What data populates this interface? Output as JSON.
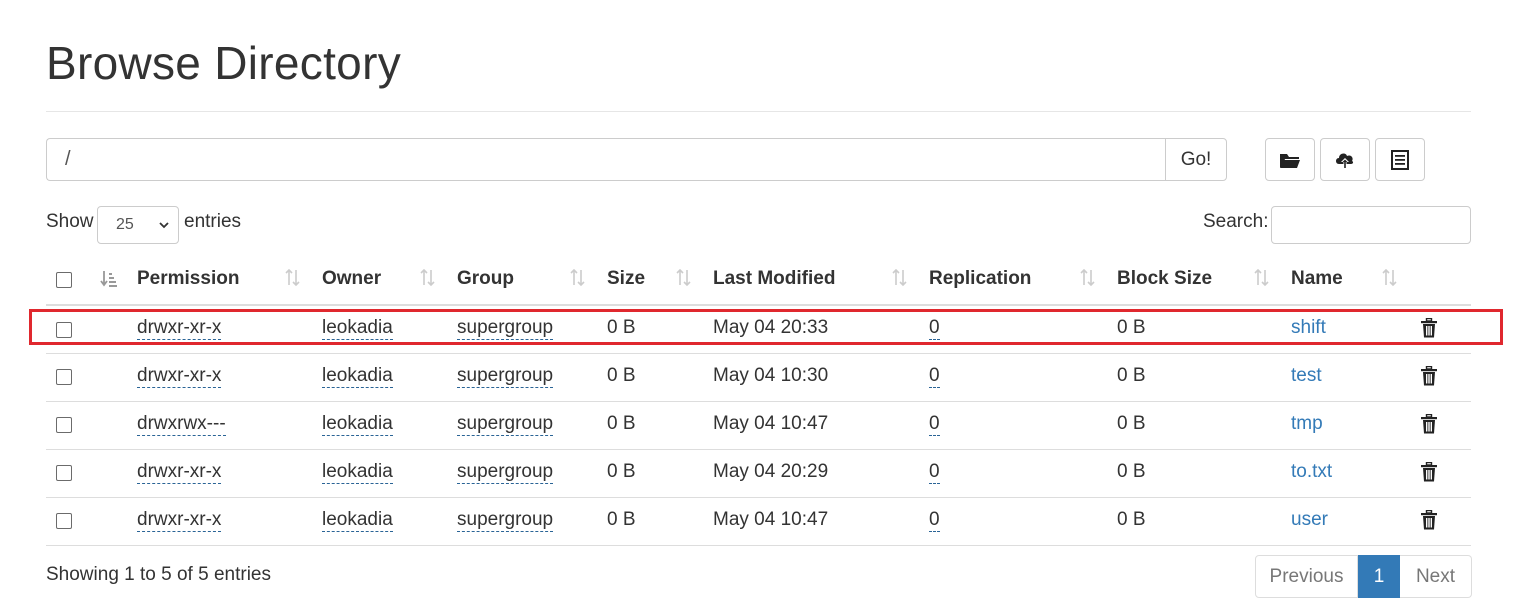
{
  "page": {
    "title": "Browse Directory"
  },
  "toolbar": {
    "path_value": "/",
    "go_label": "Go!",
    "buttons": [
      {
        "icon": "folder-open-icon",
        "tooltip": ""
      },
      {
        "icon": "cloud-upload-icon",
        "tooltip": ""
      },
      {
        "icon": "list-icon",
        "tooltip": ""
      }
    ]
  },
  "controls": {
    "show_label": "Show",
    "page_length": "25",
    "entries_label": "entries",
    "search_label": "Search:",
    "search_value": ""
  },
  "table": {
    "columns": [
      "Permission",
      "Owner",
      "Group",
      "Size",
      "Last Modified",
      "Replication",
      "Block Size",
      "Name"
    ],
    "rows": [
      {
        "permission": "drwxr-xr-x",
        "owner": "leokadia",
        "group": "supergroup",
        "size": "0 B",
        "modified": "May 04 20:33",
        "replication": "0",
        "block_size": "0 B",
        "name": "shift"
      },
      {
        "permission": "drwxr-xr-x",
        "owner": "leokadia",
        "group": "supergroup",
        "size": "0 B",
        "modified": "May 04 10:30",
        "replication": "0",
        "block_size": "0 B",
        "name": "test"
      },
      {
        "permission": "drwxrwx---",
        "owner": "leokadia",
        "group": "supergroup",
        "size": "0 B",
        "modified": "May 04 10:47",
        "replication": "0",
        "block_size": "0 B",
        "name": "tmp"
      },
      {
        "permission": "drwxr-xr-x",
        "owner": "leokadia",
        "group": "supergroup",
        "size": "0 B",
        "modified": "May 04 20:29",
        "replication": "0",
        "block_size": "0 B",
        "name": "to.txt"
      },
      {
        "permission": "drwxr-xr-x",
        "owner": "leokadia",
        "group": "supergroup",
        "size": "0 B",
        "modified": "May 04 10:47",
        "replication": "0",
        "block_size": "0 B",
        "name": "user"
      }
    ],
    "highlighted_row_index": 0,
    "highlight_color": "#e0282e"
  },
  "footer": {
    "info": "Showing 1 to 5 of 5 entries",
    "previous_label": "Previous",
    "current_page": "1",
    "next_label": "Next"
  },
  "colors": {
    "link": "#337ab7",
    "accent": "#337ab7",
    "text": "#333333"
  }
}
